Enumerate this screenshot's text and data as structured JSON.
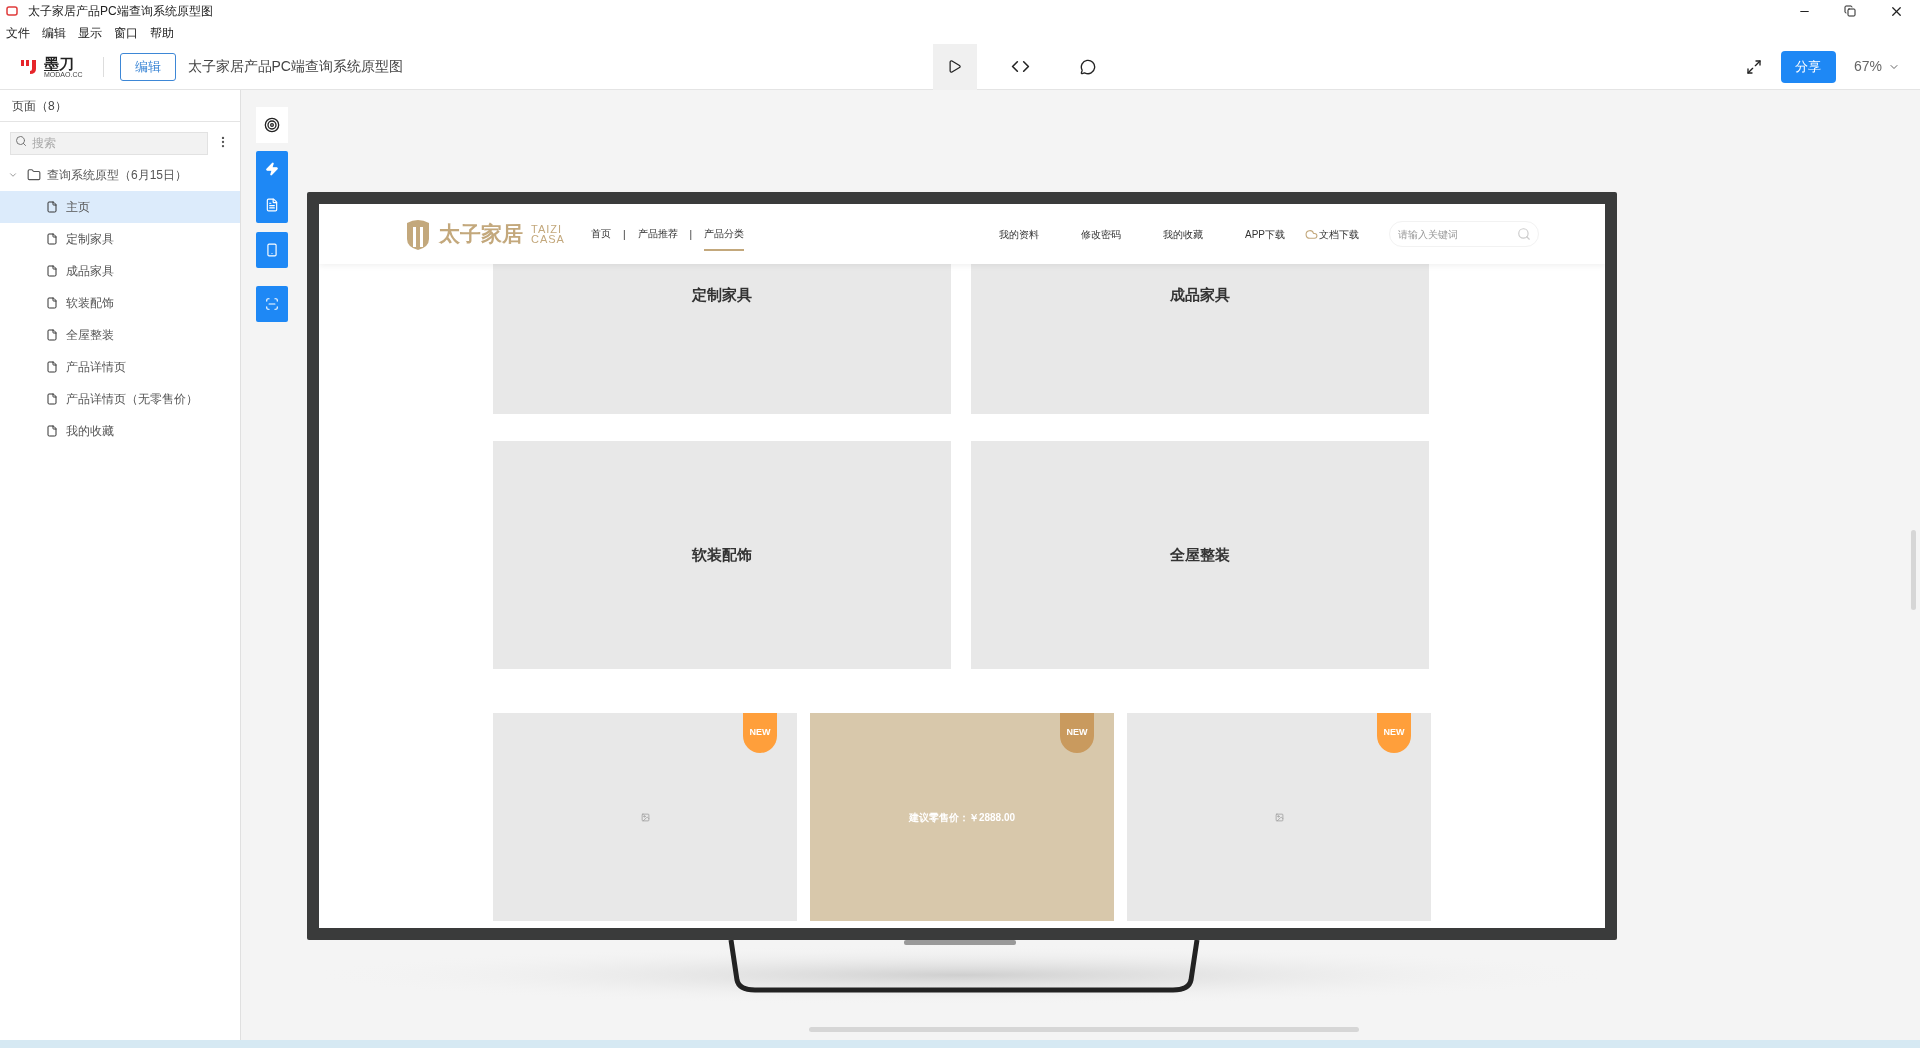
{
  "window": {
    "title": "太子家居产品PC端查询系统原型图"
  },
  "menu": [
    "文件",
    "编辑",
    "显示",
    "窗口",
    "帮助"
  ],
  "toolbar": {
    "logo_text": "墨刀",
    "logo_subtext": "MODAO.CC",
    "edit_button": "编辑",
    "doc_title": "太子家居产品PC端查询系统原型图",
    "share_button": "分享",
    "zoom": "67%"
  },
  "sidebar": {
    "header": "页面（8）",
    "search": {
      "placeholder": "搜索"
    },
    "tree": [
      {
        "label": "查询系统原型（6月15日）",
        "expanded": true,
        "selected": false,
        "children": [
          {
            "label": "主页",
            "selected": true
          },
          {
            "label": "定制家具",
            "selected": false
          },
          {
            "label": "成品家具",
            "selected": false
          },
          {
            "label": "软装配饰",
            "selected": false
          },
          {
            "label": "全屋整装",
            "selected": false
          },
          {
            "label": "产品详情页",
            "selected": false
          },
          {
            "label": "产品详情页（无零售价）",
            "selected": false
          },
          {
            "label": "我的收藏",
            "selected": false
          }
        ]
      }
    ]
  },
  "prototype": {
    "brand": {
      "name": "太子家居",
      "latin_top": "TAIZI",
      "latin_bottom": "CASA"
    },
    "nav": [
      {
        "kind": "link",
        "label": "首页",
        "selected": false
      },
      {
        "kind": "separator",
        "label": "|"
      },
      {
        "kind": "link",
        "label": "产品推荐",
        "selected": false
      },
      {
        "kind": "separator",
        "label": "|"
      },
      {
        "kind": "link",
        "label": "产品分类",
        "selected": true
      }
    ],
    "user_links": [
      {
        "label": "我的资料",
        "kind": "text"
      },
      {
        "label": "修改密码",
        "kind": "text"
      },
      {
        "label": "我的收藏",
        "kind": "text"
      },
      {
        "label": "APP下载",
        "kind": "text"
      },
      {
        "label": "文档下载",
        "kind": "cloud"
      }
    ],
    "search": {
      "placeholder": "请输入关键词"
    },
    "categories": [
      {
        "label": "定制家具"
      },
      {
        "label": "成品家具"
      },
      {
        "label": "软装配饰"
      },
      {
        "label": "全屋整装"
      }
    ],
    "products": [
      {
        "badge": "NEW",
        "highlighted": false
      },
      {
        "badge": "NEW",
        "highlighted": true,
        "price": "建议零售价：￥2888.00"
      },
      {
        "badge": "NEW",
        "highlighted": false
      }
    ]
  }
}
